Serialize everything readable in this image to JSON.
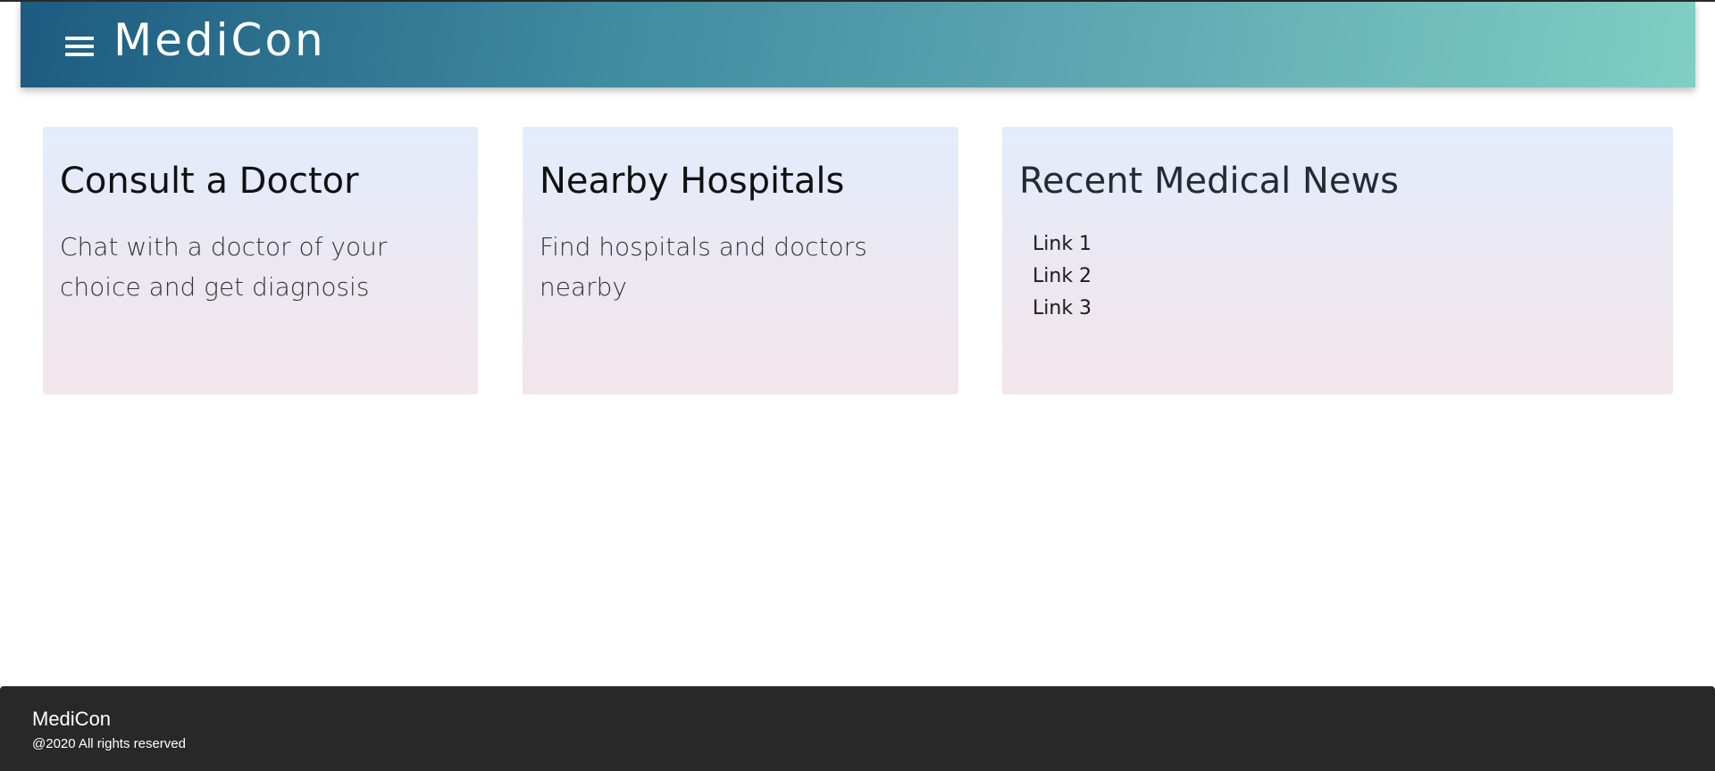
{
  "header": {
    "brand": "MediCon",
    "menu_icon": "hamburger-menu-icon"
  },
  "cards": {
    "consult": {
      "title": "Consult a Doctor",
      "text": "Chat with a doctor of your choice and get diagnosis"
    },
    "hospitals": {
      "title": "Nearby Hospitals",
      "text": "Find hospitals and doctors nearby"
    },
    "news": {
      "title": "Recent Medical News",
      "links": [
        "Link 1",
        "Link 2",
        "Link 3"
      ]
    }
  },
  "footer": {
    "brand": "MediCon",
    "copyright": "@2020 All rights reserved"
  },
  "colors": {
    "header_gradient_start": "#1d5b80",
    "header_gradient_end": "#7fcfc4",
    "card_gradient_top": "#e4ecfc",
    "card_gradient_bottom": "#f2e6ea",
    "footer_bg": "#282828"
  }
}
